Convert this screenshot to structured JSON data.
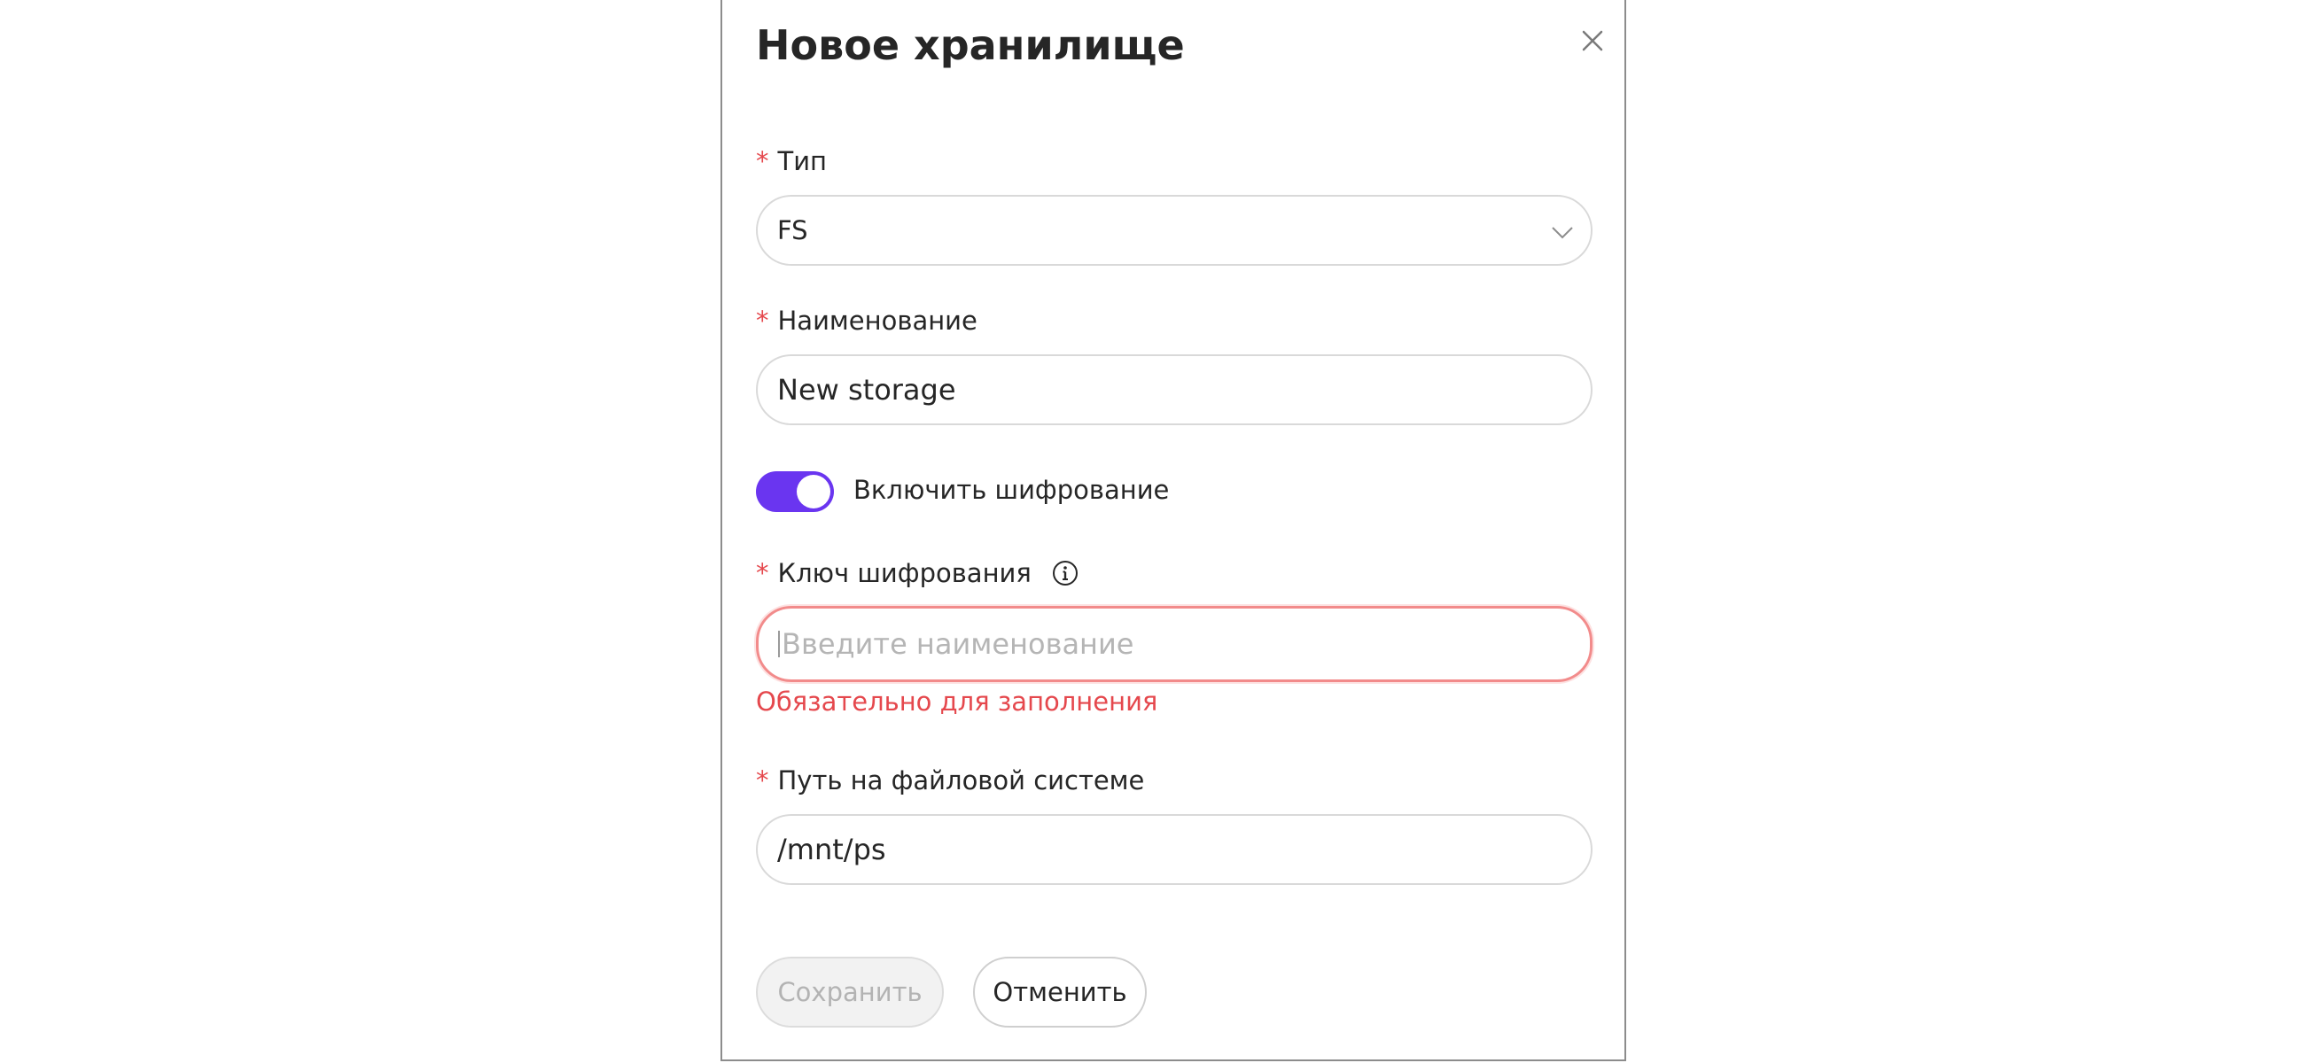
{
  "dialog": {
    "title": "Новое хранилище",
    "close_icon": "close-icon"
  },
  "form": {
    "required_mark": "*",
    "type": {
      "label": "Тип",
      "value": "FS",
      "icon": "chevron-down-icon"
    },
    "name": {
      "label": "Наименование",
      "value": "New storage"
    },
    "encryption_toggle": {
      "label": "Включить шифрование",
      "checked": true
    },
    "encryption_key": {
      "label": "Ключ шифрования",
      "info_icon": "info-icon",
      "value": "",
      "placeholder": "Введите наименование",
      "error": "Обязательно для заполнения"
    },
    "fs_path": {
      "label": "Путь на файловой системе",
      "value": "/mnt/ps"
    }
  },
  "actions": {
    "save_label": "Сохранить",
    "save_disabled": true,
    "cancel_label": "Отменить"
  },
  "colors": {
    "accent": "#6a35f0",
    "error": "#e5484d",
    "required": "#e5484d"
  }
}
